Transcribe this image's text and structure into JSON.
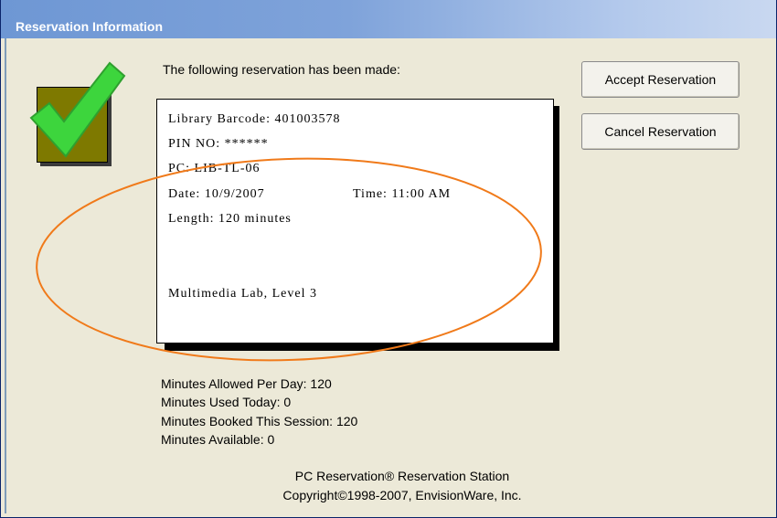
{
  "window": {
    "title": "Reservation Information"
  },
  "intro_text": "The following reservation has been made:",
  "ticket": {
    "barcode": "Library Barcode: 401003578",
    "pin": "PIN NO: ******",
    "pc": "PC: LIB-TL-06",
    "date": "Date: 10/9/2007",
    "time": "Time: 11:00 AM",
    "length": "Length: 120 minutes",
    "location": "Multimedia Lab, Level 3"
  },
  "buttons": {
    "accept": "Accept Reservation",
    "cancel": "Cancel Reservation"
  },
  "stats": {
    "allowed": "Minutes Allowed Per Day: 120",
    "used": "Minutes Used Today: 0",
    "booked": "Minutes Booked This Session: 120",
    "available": "Minutes Available: 0"
  },
  "footer": {
    "product": "PC Reservation® Reservation Station",
    "copyright": "Copyright©1998-2007, EnvisionWare, Inc."
  },
  "colors": {
    "titlebar": "#7fa3da",
    "check": "#3dd53d",
    "annotation": "#f07a1a"
  },
  "icons": {
    "check": "checkmark-icon"
  }
}
